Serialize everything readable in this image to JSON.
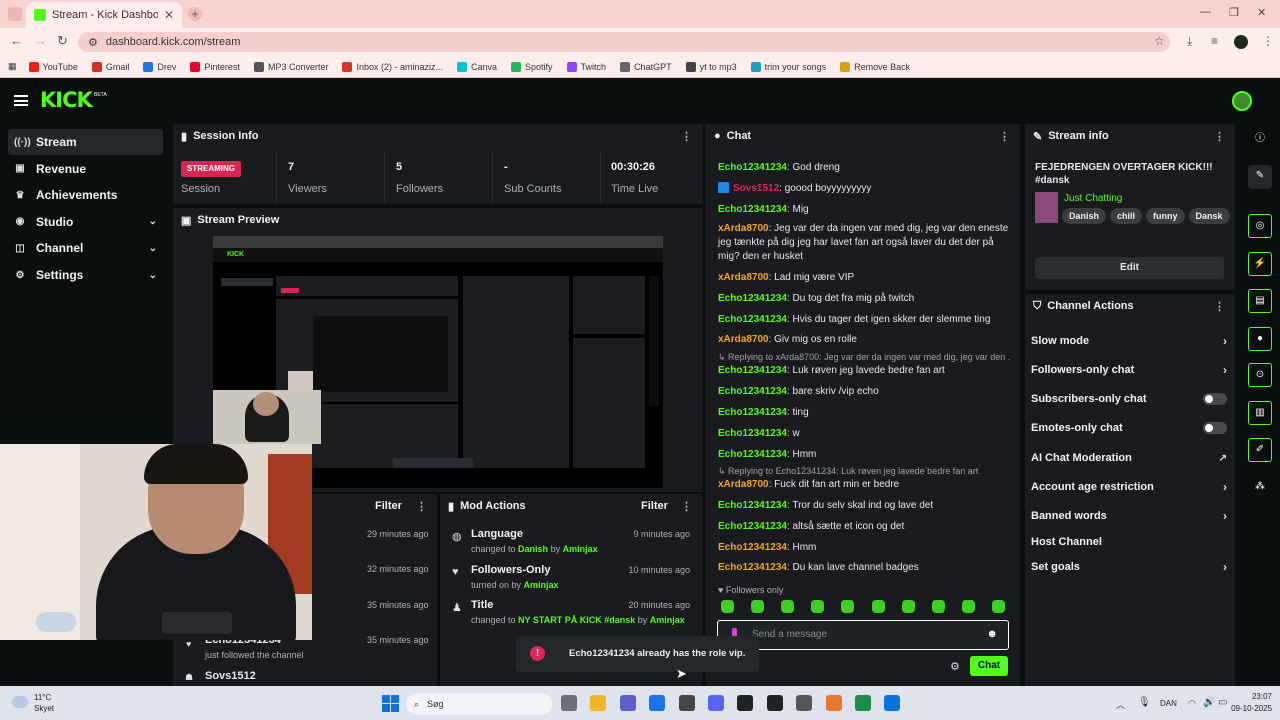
{
  "browser": {
    "tab_title": "Stream - Kick Dashboard",
    "new_tab": "+",
    "url": "dashboard.kick.com/stream",
    "bookmarks": [
      {
        "label": "YouTube",
        "color": "#e62117"
      },
      {
        "label": "Gmail",
        "color": "#d93025"
      },
      {
        "label": "Drev",
        "color": "#1a73e8"
      },
      {
        "label": "Pinterest",
        "color": "#e60023"
      },
      {
        "label": "MP3 Converter",
        "color": "#555555"
      },
      {
        "label": "Inbox (2) - aminaziz...",
        "color": "#d93025"
      },
      {
        "label": "Canva",
        "color": "#00c4cc"
      },
      {
        "label": "Spotify",
        "color": "#1db954"
      },
      {
        "label": "Twitch",
        "color": "#9146ff"
      },
      {
        "label": "ChatGPT",
        "color": "#666666"
      },
      {
        "label": "yt to mp3",
        "color": "#444444"
      },
      {
        "label": "trim your songs",
        "color": "#18a0c8"
      },
      {
        "label": "Remove Back",
        "color": "#d4a017"
      }
    ]
  },
  "header": {
    "logo": "KICK",
    "beta": "BETA"
  },
  "sidebar": {
    "items": [
      {
        "label": "Stream",
        "icon": "broadcast-icon",
        "glyph": "((·))",
        "active": true
      },
      {
        "label": "Revenue",
        "icon": "revenue-icon",
        "glyph": "▣"
      },
      {
        "label": "Achievements",
        "icon": "trophy-icon",
        "glyph": "♛"
      },
      {
        "label": "Studio",
        "icon": "studio-icon",
        "glyph": "◉",
        "expandable": true
      },
      {
        "label": "Channel",
        "icon": "channel-icon",
        "glyph": "◫",
        "expandable": true
      },
      {
        "label": "Settings",
        "icon": "gear-icon",
        "glyph": "⚙",
        "expandable": true
      }
    ]
  },
  "session": {
    "title": "Session Info",
    "status": "STREAMING",
    "status_label": "Session",
    "stats": [
      {
        "value": "7",
        "label": "Viewers"
      },
      {
        "value": "5",
        "label": "Followers"
      },
      {
        "value": "-",
        "label": "Sub Counts"
      },
      {
        "value": "00:30:26",
        "label": "Time Live"
      }
    ]
  },
  "preview": {
    "title": "Stream Preview"
  },
  "activity_feed": {
    "filter": "Filter",
    "items": [
      {
        "time": "29 minutes ago"
      },
      {
        "time": "32 minutes ago"
      },
      {
        "time": "35 minutes ago"
      },
      {
        "name": "Echo12341234",
        "detail": "just followed the channel",
        "time": "35 minutes ago"
      },
      {
        "name": "Sovs1512"
      }
    ]
  },
  "mod_actions": {
    "title": "Mod Actions",
    "filter": "Filter",
    "items": [
      {
        "title": "Language",
        "pre": "changed to ",
        "value": "Danish",
        "mid": " by ",
        "user": "Aminjax",
        "time": "9 minutes ago",
        "icon": "globe-icon",
        "glyph": "◍"
      },
      {
        "title": "Followers-Only",
        "pre": "turned on by ",
        "value": "",
        "mid": "",
        "user": "Aminjax",
        "time": "10 minutes ago",
        "icon": "heart-icon",
        "glyph": "♥"
      },
      {
        "title": "Title",
        "pre": "changed to ",
        "value": "NY START PÅ KICK #dansk",
        "mid": " by ",
        "user": "Aminjax",
        "time": "20 minutes ago",
        "icon": "user-edit-icon",
        "glyph": "♟"
      }
    ]
  },
  "chat": {
    "title": "Chat",
    "messages": [
      {
        "user": "Echo12341234",
        "color": "#53fc18",
        "text": ": God dreng"
      },
      {
        "user": "Sovs1512",
        "color": "#e0245e",
        "text": ": goood boyyyyyyyyy",
        "badge": true
      },
      {
        "user": "Echo12341234",
        "color": "#53fc18",
        "text": ": Mig"
      },
      {
        "user": "xArda8700",
        "color": "#f5a623",
        "text": ": Jeg var der da ingen var med dig, jeg var den eneste jeg tænkte på dig jeg har lavet fan art også laver du det der på mig? den er husket"
      },
      {
        "user": "xArda8700",
        "color": "#f5a623",
        "text": ": Lad mig være VIP"
      },
      {
        "user": "Echo12341234",
        "color": "#53fc18",
        "text": ": Du tog det fra mig på twitch"
      },
      {
        "user": "Echo12341234",
        "color": "#53fc18",
        "text": ": Hvis du tager det igen skker der slemme ting"
      },
      {
        "user": "xArda8700",
        "color": "#f5a623",
        "text": ": Giv mig os en rolle"
      },
      {
        "reply": "Replying to xArda8700: Jeg var der da ingen var med dig, jeg var den ..."
      },
      {
        "user": "Echo12341234",
        "color": "#53fc18",
        "text": ": Luk røven jeg lavede bedre fan art"
      },
      {
        "user": "Echo12341234",
        "color": "#53fc18",
        "text": ": bare skriv /vip echo"
      },
      {
        "user": "Echo12341234",
        "color": "#53fc18",
        "text": ": ting"
      },
      {
        "user": "Echo12341234",
        "color": "#53fc18",
        "text": ": w"
      },
      {
        "user": "Echo12341234",
        "color": "#53fc18",
        "text": ": Hmm"
      },
      {
        "reply": "Replying to Echo12341234: Luk røven jeg lavede bedre fan art"
      },
      {
        "user": "xArda8700",
        "color": "#f5a623",
        "text": ": Fuck dit fan art min er bedre"
      },
      {
        "user": "Echo12341234",
        "color": "#53fc18",
        "text": ": Tror du selv skal ind og lave det"
      },
      {
        "user": "Echo12341234",
        "color": "#53fc18",
        "text": ": altså sætte et icon og det"
      },
      {
        "user": "Echo12341234",
        "color": "#f5a623",
        "text": ": Hmm"
      },
      {
        "user": "Echo12341234",
        "color": "#f5a623",
        "text": ": Du kan lave channel badges"
      }
    ],
    "followers_only": "Followers only",
    "input_placeholder": "Send a message",
    "send": "Chat"
  },
  "toast": {
    "text": "Echo12341234 already has the role vip."
  },
  "stream_info": {
    "title": "Stream info",
    "stream_title": "FEJEDRENGEN OVERTAGER KICK!!! #dansk",
    "category": "Just Chatting",
    "tags": [
      "Danish",
      "chill",
      "funny",
      "Dansk"
    ],
    "edit": "Edit"
  },
  "channel_actions": {
    "title": "Channel Actions",
    "items": [
      {
        "label": "Slow mode",
        "kind": "chevron"
      },
      {
        "label": "Followers-only chat",
        "kind": "chevron"
      },
      {
        "label": "Subscribers-only chat",
        "kind": "toggle"
      },
      {
        "label": "Emotes-only chat",
        "kind": "toggle"
      },
      {
        "label": "AI Chat Moderation",
        "kind": "external"
      },
      {
        "label": "Account age restriction",
        "kind": "chevron"
      },
      {
        "label": "Banned words",
        "kind": "chevron"
      },
      {
        "label": "Host Channel",
        "kind": "none"
      },
      {
        "label": "Set goals",
        "kind": "chevron"
      }
    ]
  },
  "right_rail": [
    "info-icon",
    "pencil-icon",
    "target-icon",
    "bolt-icon",
    "clipboard-icon",
    "chat-bubble-icon",
    "radio-icon",
    "layout-icon",
    "wrench-icon",
    "group-icon"
  ],
  "taskbar": {
    "weather_temp": "11°C",
    "weather_desc": "Skyet",
    "search": "Søg",
    "lang": "DAN",
    "time": "23:07",
    "date": "09-10-2025"
  }
}
